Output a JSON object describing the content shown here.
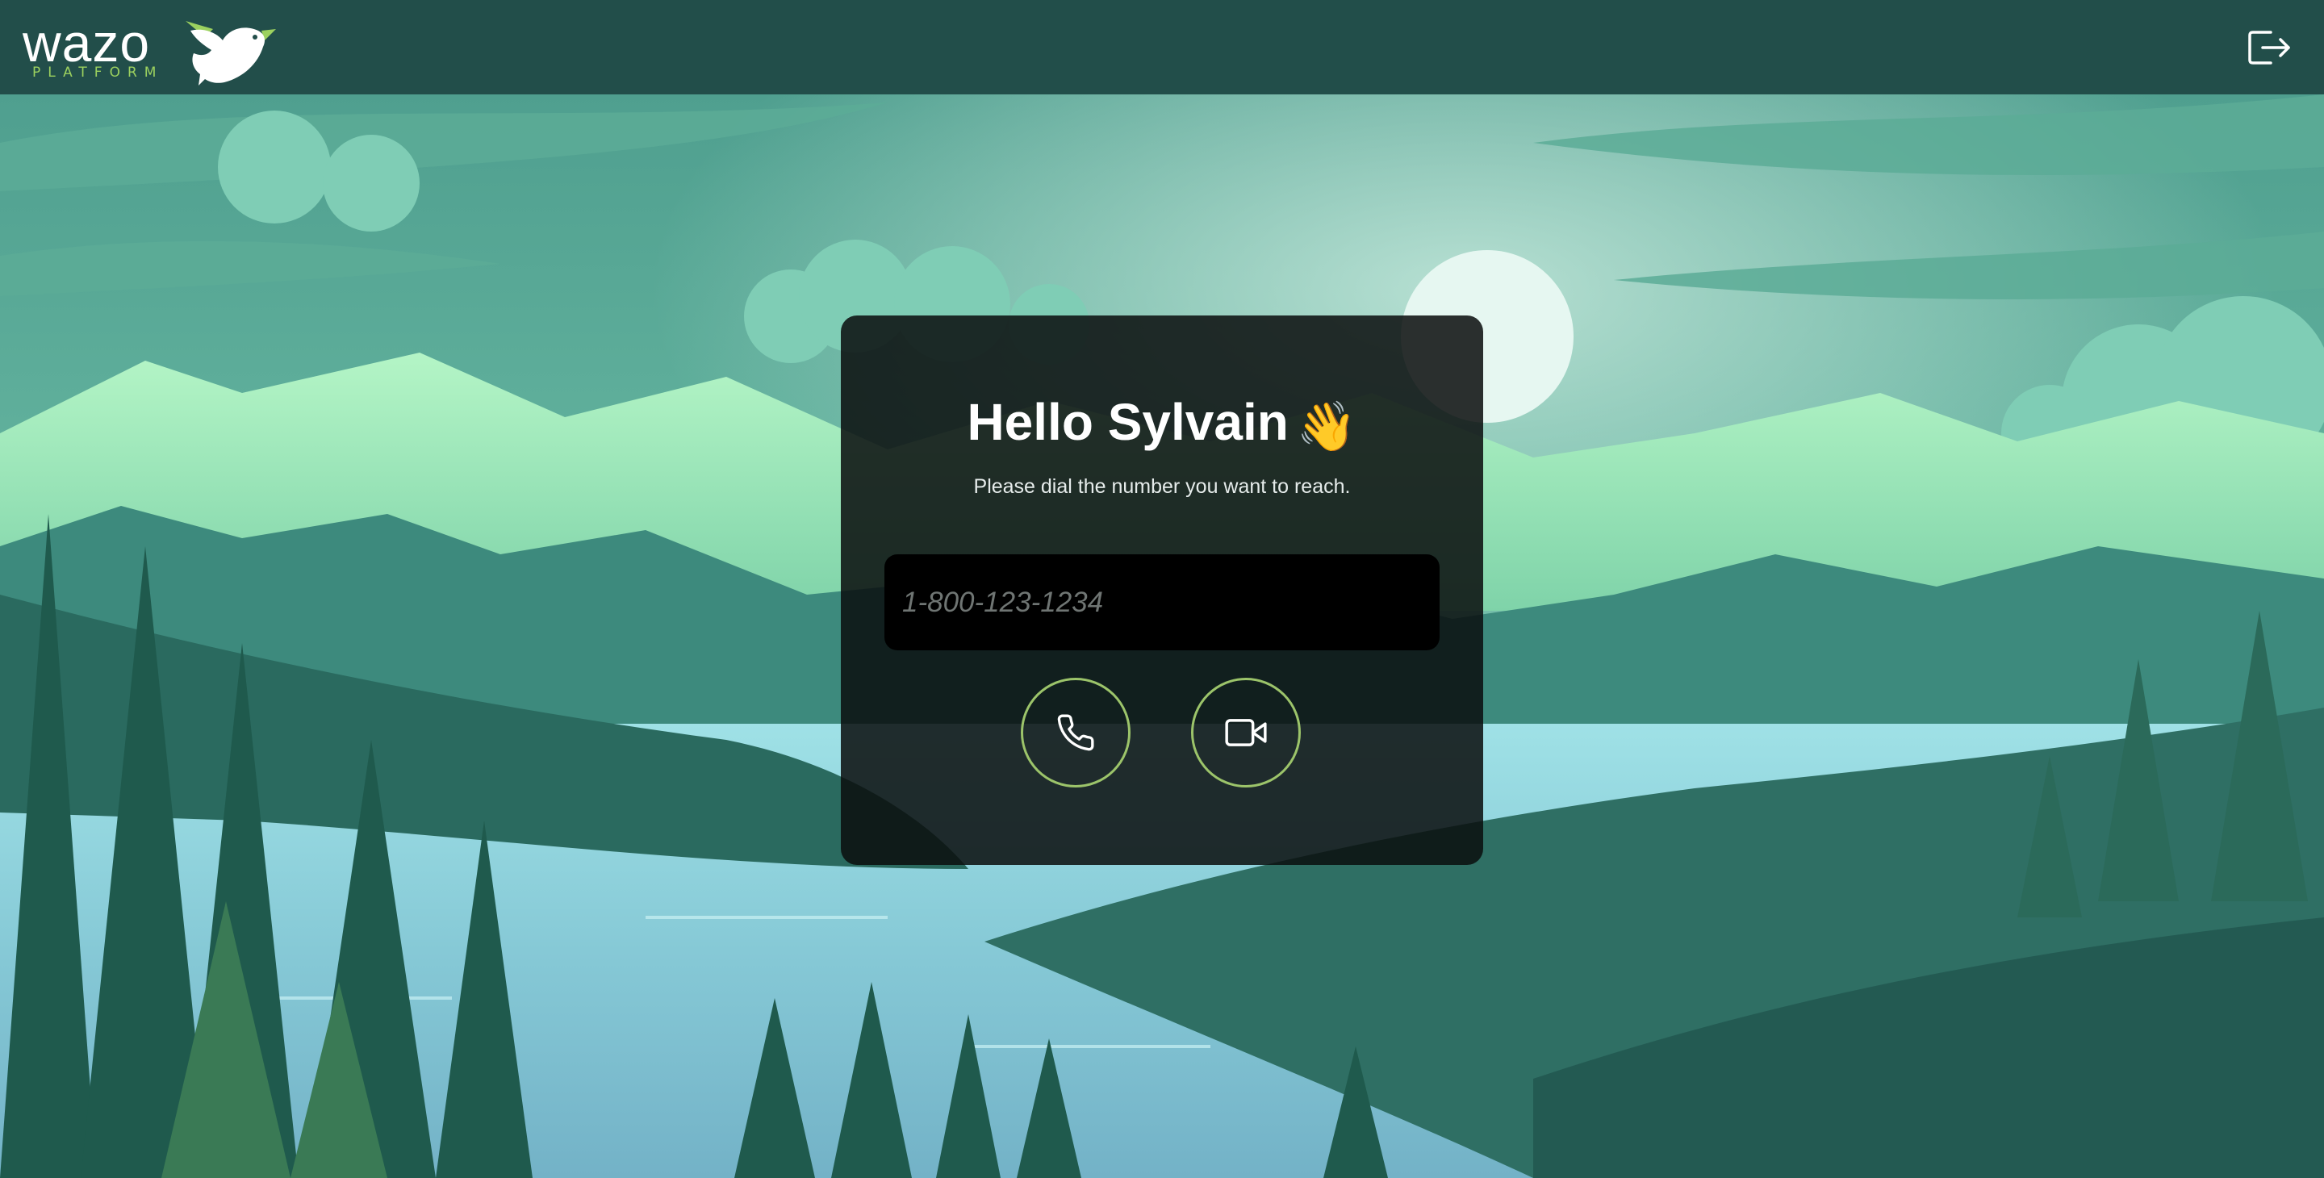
{
  "header": {
    "logo_text": "wazo",
    "logo_subtext": "PLATFORM",
    "logout_icon": "logout-icon",
    "background_color": "#224e4a"
  },
  "dialer": {
    "greeting": "Hello Sylvain",
    "greeting_emoji": "👋",
    "subtitle": "Please dial the number you want to reach.",
    "input_placeholder": "1-800-123-1234",
    "input_value": "",
    "audio_call_icon": "phone-icon",
    "video_call_icon": "video-camera-icon",
    "button_border_color": "#9cc46a"
  },
  "background": {
    "theme": "forest-lake-landscape",
    "colors": [
      "#5fae9c",
      "#a9efbe",
      "#2c6c61",
      "#8ad0dc"
    ]
  }
}
